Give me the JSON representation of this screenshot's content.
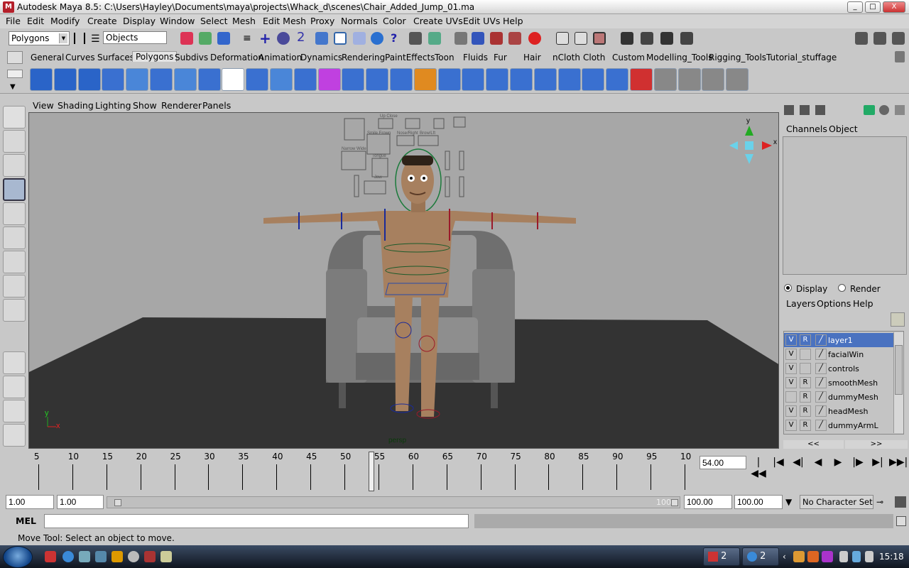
{
  "window": {
    "title": "Autodesk Maya 8.5: C:\\Users\\Hayley\\Documents\\maya\\projects\\Whack_d\\scenes\\Chair_Added_Jump_01.ma",
    "minimize": "_",
    "maximize": "□",
    "close": "X"
  },
  "menubar": [
    "File",
    "Edit",
    "Modify",
    "Create",
    "Display",
    "Window",
    "Select",
    "Mesh",
    "Edit Mesh",
    "Proxy",
    "Normals",
    "Color",
    "Create UVs",
    "Edit UVs",
    "Help"
  ],
  "statusline": {
    "mode": "Polygons",
    "selection_field": "Objects"
  },
  "shelf_tabs": [
    "General",
    "Curves",
    "Surfaces",
    "Polygons",
    "Subdivs",
    "Deformation",
    "Animation",
    "Dynamics",
    "Rendering",
    "PaintEffects",
    "Toon",
    "Fluids",
    "Fur",
    "Hair",
    "nCloth",
    "Cloth",
    "Custom",
    "Modelling_Tools",
    "Rigging_Tools",
    "Tutorial_stuffage"
  ],
  "active_shelf_tab": "Polygons",
  "panel_menu": [
    "View",
    "Shading",
    "Lighting",
    "Show",
    "Renderer",
    "Panels"
  ],
  "viewport": {
    "camera_label": "persp",
    "axis_x": "x",
    "axis_y": "y",
    "face_gui_labels": [
      "Smile Frown",
      "Nose/Right",
      "Brow/Lft",
      "Narrow Wide",
      "Tongue",
      "Jaw",
      "Up Close"
    ]
  },
  "channel_box": {
    "tabs": [
      "Channels",
      "Object"
    ]
  },
  "layer_editor": {
    "display_label": "Display",
    "render_label": "Render",
    "selected_mode": "Display",
    "menus": [
      "Layers",
      "Options",
      "Help"
    ],
    "layers": [
      {
        "v": "V",
        "r": "R",
        "name": "layer1",
        "selected": true
      },
      {
        "v": "V",
        "r": "",
        "name": "facialWin",
        "selected": false
      },
      {
        "v": "V",
        "r": "",
        "name": "controls",
        "selected": false
      },
      {
        "v": "V",
        "r": "R",
        "name": "smoothMesh",
        "selected": false
      },
      {
        "v": "",
        "r": "R",
        "name": "dummyMesh",
        "selected": false
      },
      {
        "v": "V",
        "r": "R",
        "name": "headMesh",
        "selected": false
      },
      {
        "v": "V",
        "r": "R",
        "name": "dummyArmL",
        "selected": false
      }
    ],
    "scroll_left": "<<",
    "scroll_right": ">>"
  },
  "timeline": {
    "ticks": [
      "5",
      "10",
      "15",
      "20",
      "25",
      "30",
      "35",
      "40",
      "45",
      "50",
      "55",
      "60",
      "65",
      "70",
      "75",
      "80",
      "85",
      "90",
      "95",
      "10"
    ],
    "current_time": "54.00",
    "playhead_frame": 54
  },
  "playback": [
    "|◀◀",
    "|◀",
    "◀|",
    "◀",
    "▶",
    "|▶",
    "▶|",
    "▶▶|"
  ],
  "range": {
    "start_time": "1.00",
    "start_range": "1.00",
    "range_end_label": "100",
    "end_range": "100.00",
    "end_time": "100.00",
    "character_set": "No Character Set"
  },
  "command_line": {
    "label": "MEL",
    "value": ""
  },
  "help_line": {
    "text": "Move Tool: Select an object to move."
  },
  "taskbar": {
    "clock": "15:18",
    "group1_count": "2",
    "group2_count": "2"
  }
}
